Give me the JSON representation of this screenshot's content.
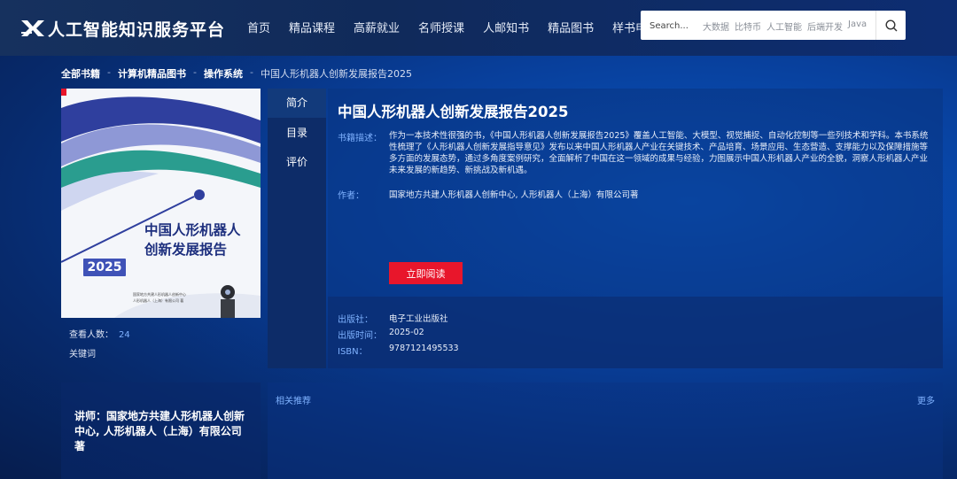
{
  "header": {
    "logo_text": "人工智能知识服务平台",
    "nav": [
      "首页",
      "精品课程",
      "高薪就业",
      "名师授课",
      "人邮知书",
      "精品图书",
      "样书申请"
    ],
    "search": {
      "placeholder": "Search...",
      "tags": [
        "大数据",
        "比特币",
        "人工智能",
        "后端开发",
        "Java"
      ]
    }
  },
  "breadcrumb": {
    "items": [
      "全部书籍",
      "计算机精品图书",
      "操作系统"
    ],
    "separator": "-",
    "current": "中国人形机器人创新发展报告2025"
  },
  "cover": {
    "title_line1": "中国人形机器人",
    "title_line2": "创新发展报告",
    "badge": "2025",
    "small_line1": "国家地方共建人形机器人创新中心",
    "small_line2": "人形机器人（上海）有限公司 著"
  },
  "stats": {
    "views_label": "查看人数：",
    "views": "24",
    "keywords_label": "关键词"
  },
  "tabs": [
    "简介",
    "目录",
    "评价"
  ],
  "book": {
    "title": "中国人形机器人创新发展报告2025",
    "desc_label": "书籍描述：",
    "description": "作为一本技术性很强的书，《中国人形机器人创新发展报告2025》覆盖人工智能、大模型、视觉捕捉、自动化控制等一些列技术和学科。本书系统性梳理了《人形机器人创新发展指导意见》发布以来中国人形机器人产业在关键技术、产品培育、场景应用、生态营造、支撑能力以及保障措施等多方面的发展态势，通过多角度案例研究，全面解析了中国在这一领域的成果与经验，力图展示中国人形机器人产业的全貌，洞察人形机器人产业未来发展的新趋势、新挑战及新机遇。",
    "author_label": "作者：",
    "author": "国家地方共建人形机器人创新中心, 人形机器人（上海）有限公司著",
    "read_button": "立即阅读",
    "publisher_label": "出版社：",
    "publisher": "电子工业出版社",
    "date_label": "出版时间：",
    "date": "2025-02",
    "isbn_label": "ISBN：",
    "isbn": "9787121495533"
  },
  "lecturer": "讲师：国家地方共建人形机器人创新中心, 人形机器人（上海）有限公司著",
  "recommend": {
    "label": "相关推荐",
    "more": "更多"
  },
  "colors": {
    "accent_blue": "#7fb2ff",
    "read_button": "#e8162b",
    "cover_badge": "#3f52b7"
  }
}
